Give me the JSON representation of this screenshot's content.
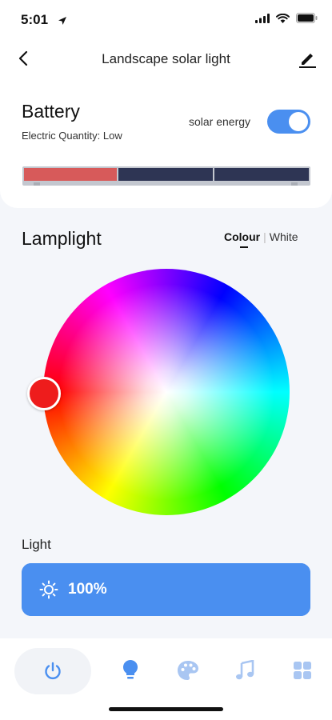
{
  "status_bar": {
    "time": "5:01"
  },
  "header": {
    "title": "Landscape solar light"
  },
  "battery": {
    "title": "Battery",
    "subtitle": "Electric Quantity: Low",
    "solar_label": "solar energy",
    "solar_enabled": true
  },
  "lamplight": {
    "title": "Lamplight",
    "tabs": [
      "Colour",
      "White"
    ],
    "active_tab": "Colour",
    "selected_color": "#ee1c1c"
  },
  "light": {
    "label": "Light",
    "value_text": "100%",
    "level": 1.0
  },
  "nav": {
    "items": [
      "power-icon",
      "bulb-icon",
      "palette-icon",
      "music-icon",
      "grid-icon"
    ]
  },
  "colors": {
    "accent": "#4a8ff0",
    "battery_low": "#d75a5a",
    "battery_empty": "#2e3554",
    "nav_icon_inactive": "#a9c6f2"
  }
}
